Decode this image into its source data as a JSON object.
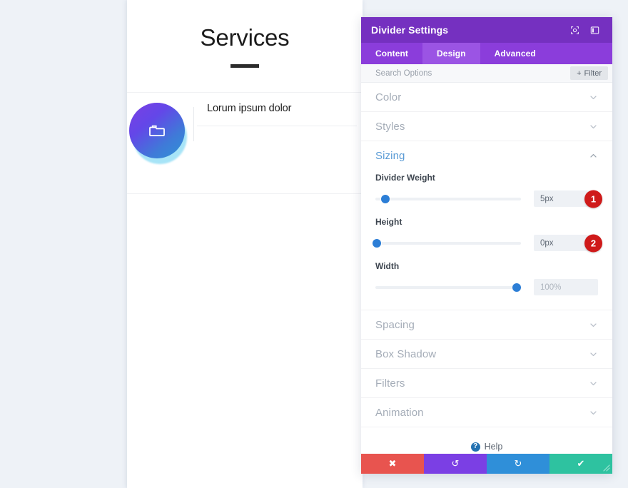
{
  "preview": {
    "hero": {
      "title": "Services",
      "divider_icon": "horizontal-rule"
    },
    "service": {
      "title": "Lorum ipsum dolor",
      "icon": "folder-icon",
      "icon_gradient_from": "#7b3fe4",
      "icon_gradient_to": "#2f92d6",
      "icon_glow_color": "#a7e4f7"
    }
  },
  "panel": {
    "title": "Divider Settings",
    "titlebar_icons": [
      {
        "name": "responsive-preview-icon",
        "glyph": "⌖"
      },
      {
        "name": "panel-layout-icon",
        "glyph": "◫"
      }
    ],
    "accent_color": "#7530c0",
    "tabs": [
      {
        "label": "Content",
        "active": false
      },
      {
        "label": "Design",
        "active": true
      },
      {
        "label": "Advanced",
        "active": false
      }
    ],
    "search": {
      "value": "",
      "placeholder": "Search Options"
    },
    "filter_button": {
      "label": "Filter",
      "plus": "+"
    },
    "sections": [
      {
        "id": "color",
        "label": "Color",
        "open": false,
        "chevron": "down"
      },
      {
        "id": "styles",
        "label": "Styles",
        "open": false,
        "chevron": "down"
      },
      {
        "id": "sizing",
        "label": "Sizing",
        "open": true,
        "chevron": "up"
      },
      {
        "id": "spacing",
        "label": "Spacing",
        "open": false,
        "chevron": "down"
      },
      {
        "id": "box-shadow",
        "label": "Box Shadow",
        "open": false,
        "chevron": "down"
      },
      {
        "id": "filters",
        "label": "Filters",
        "open": false,
        "chevron": "down"
      },
      {
        "id": "animation",
        "label": "Animation",
        "open": false,
        "chevron": "down"
      }
    ],
    "sizing_controls": [
      {
        "id": "divider-weight",
        "label": "Divider Weight",
        "value": "5px",
        "placeholder": "",
        "slider_percent": 7,
        "badge": "1"
      },
      {
        "id": "height",
        "label": "Height",
        "value": "0px",
        "placeholder": "",
        "slider_percent": 1,
        "badge": "2"
      },
      {
        "id": "width",
        "label": "Width",
        "value": "",
        "placeholder": "100%",
        "slider_percent": 97,
        "badge": ""
      }
    ],
    "badge_color": "#cf1a1a",
    "help": {
      "label": "Help",
      "icon_glyph": "?"
    },
    "footer_buttons": [
      {
        "id": "cancel",
        "name": "cancel-button",
        "icon": "close-icon",
        "glyph": "✖",
        "color": "#e8544f"
      },
      {
        "id": "undo",
        "name": "undo-button",
        "icon": "undo-icon",
        "glyph": "↺",
        "color": "#7b3fe4"
      },
      {
        "id": "redo",
        "name": "redo-button",
        "icon": "redo-icon",
        "glyph": "↻",
        "color": "#2f8fd9"
      },
      {
        "id": "save",
        "name": "save-button",
        "icon": "check-icon",
        "glyph": "✔",
        "color": "#2ec2a0"
      }
    ]
  }
}
